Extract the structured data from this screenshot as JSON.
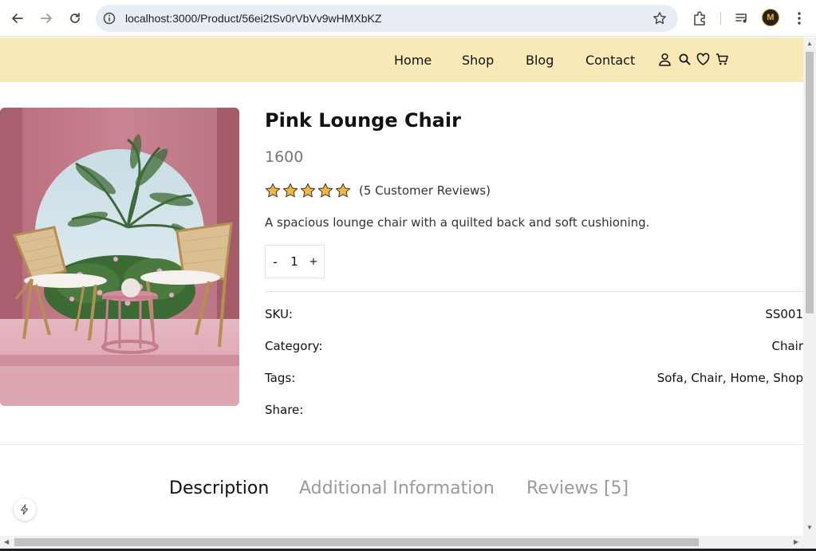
{
  "browser": {
    "url": "localhost:3000/Product/56ei2tSv0rVbVv9wHMXbKZ",
    "avatar_letter": "M"
  },
  "nav": {
    "items": [
      {
        "label": "Home"
      },
      {
        "label": "Shop"
      },
      {
        "label": "Blog"
      },
      {
        "label": "Contact"
      }
    ],
    "icons": [
      "user-icon",
      "search-icon",
      "heart-icon",
      "cart-icon"
    ],
    "background": "#f9e9b7"
  },
  "product": {
    "title": "Pink Lounge Chair",
    "price": "1600",
    "rating": 5,
    "rating_max": 5,
    "reviews_text": "(5 Customer Reviews)",
    "description": "A spacious lounge chair with a quilted back and soft cushioning.",
    "quantity": {
      "minus": "-",
      "value": "1",
      "plus": "+"
    },
    "meta": {
      "sku_label": "SKU:",
      "sku_value": "SS001",
      "category_label": "Category:",
      "category_value": "Chair",
      "tags_label": "Tags:",
      "tags_value": "Sofa, Chair, Home, Shop",
      "share_label": "Share:"
    }
  },
  "tabs": [
    {
      "label": "Description"
    },
    {
      "label": "Additional Information"
    },
    {
      "label": "Reviews [5]"
    }
  ],
  "colors": {
    "star": "#f4b63c",
    "muted_tab": "#9a9a9a"
  }
}
